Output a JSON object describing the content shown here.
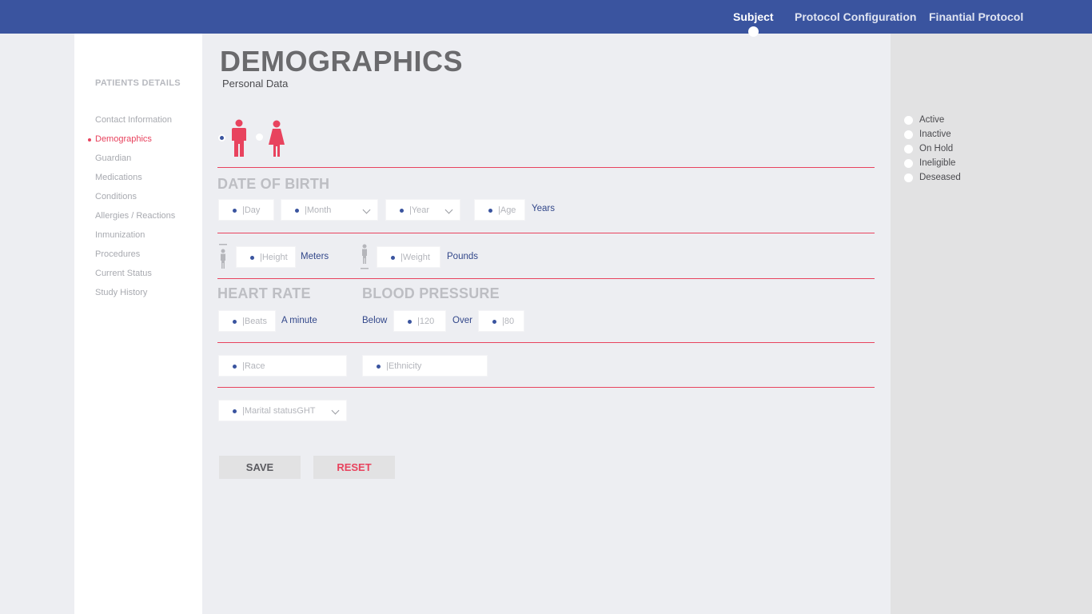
{
  "topnav": {
    "items": [
      {
        "label": "Subject",
        "active": true
      },
      {
        "label": "Protocol Configuration",
        "active": false
      },
      {
        "label": "Finantial Protocol",
        "active": false
      }
    ]
  },
  "sidebar": {
    "heading": "PATIENTS DETAILS",
    "items": [
      {
        "label": "Contact Information"
      },
      {
        "label": "Demographics",
        "active": true
      },
      {
        "label": "Guardian"
      },
      {
        "label": "Medications"
      },
      {
        "label": "Conditions"
      },
      {
        "label": "Allergies / Reactions"
      },
      {
        "label": "Inmunization"
      },
      {
        "label": "Procedures"
      },
      {
        "label": "Current Status"
      },
      {
        "label": "Study History"
      }
    ]
  },
  "header": {
    "title": "DEMOGRAPHICS",
    "subtitle": "Personal Data"
  },
  "gender": {
    "selected": "male",
    "male_icon": "male-figure-icon",
    "female_icon": "female-figure-icon"
  },
  "dob": {
    "title": "DATE OF BIRTH",
    "day_placeholder": "|Day",
    "month_placeholder": "|Month",
    "year_placeholder": "|Year",
    "age_placeholder": "|Age",
    "age_unit": "Years"
  },
  "body": {
    "height_placeholder": "|Height",
    "height_unit": "Meters",
    "weight_placeholder": "|Weight",
    "weight_unit": "Pounds"
  },
  "vitals": {
    "heart_rate_title": "HEART RATE",
    "blood_pressure_title": "BLOOD PRESSURE",
    "beats_placeholder": "|Beats",
    "beats_unit": "A minute",
    "below_label": "Below",
    "systolic_placeholder": "|120",
    "over_label": "Over",
    "diastolic_placeholder": "|80"
  },
  "origin": {
    "race_placeholder": "|Race",
    "ethnicity_placeholder": "|Ethnicity"
  },
  "marital": {
    "placeholder": "|Marital statusGHT"
  },
  "actions": {
    "save_label": "SAVE",
    "reset_label": "RESET"
  },
  "status_options": [
    "Active",
    "Inactive",
    "On Hold",
    "Ineligible",
    "Deseased"
  ],
  "colors": {
    "topbar": "#3a549f",
    "accent": "#e8435e",
    "unit_text": "#32478a"
  }
}
